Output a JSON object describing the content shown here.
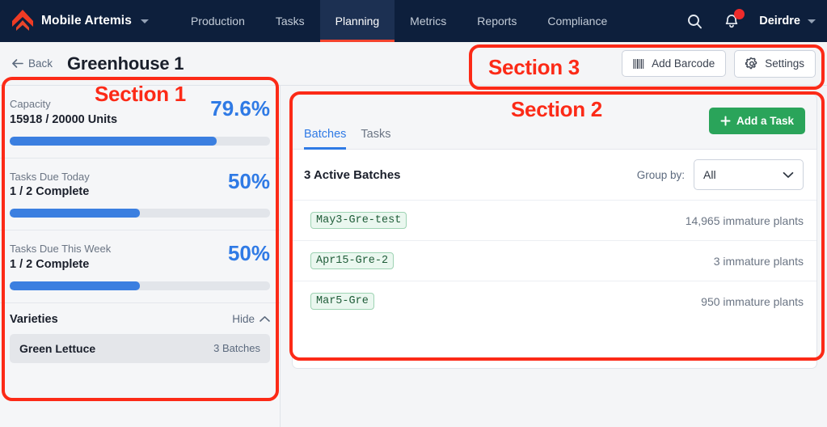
{
  "navbar": {
    "brand": "Mobile Artemis",
    "brand_caret_icon": "chevron-down-icon",
    "logo_icon": "flame-chevron-logo",
    "links": [
      {
        "label": "Production",
        "active": false
      },
      {
        "label": "Tasks",
        "active": false
      },
      {
        "label": "Planning",
        "active": true
      },
      {
        "label": "Metrics",
        "active": false
      },
      {
        "label": "Reports",
        "active": false
      },
      {
        "label": "Compliance",
        "active": false
      }
    ],
    "search_icon": "search-icon",
    "notifications_icon": "bell-icon",
    "notification_badge": true,
    "user": "Deirdre",
    "user_caret_icon": "chevron-down-icon",
    "background_color": "#0d1f3c",
    "active_underline_color": "#f4442e"
  },
  "page_header": {
    "back_label": "Back",
    "back_icon": "arrow-left-icon",
    "title": "Greenhouse 1",
    "actions": [
      {
        "label": "Add Barcode",
        "icon": "barcode-icon"
      },
      {
        "label": "Settings",
        "icon": "gear-icon"
      }
    ]
  },
  "sidebar": {
    "stats": [
      {
        "label": "Capacity",
        "sub": "15918 / 20000 Units",
        "percent_label": "79.6%",
        "percent_value": 79.6
      },
      {
        "label": "Tasks Due Today",
        "sub": "1 / 2 Complete",
        "percent_label": "50%",
        "percent_value": 50
      },
      {
        "label": "Tasks Due This Week",
        "sub": "1 / 2 Complete",
        "percent_label": "50%",
        "percent_value": 50
      }
    ],
    "varieties": {
      "title": "Varieties",
      "toggle_label": "Hide",
      "toggle_icon": "chevron-up-icon",
      "items": [
        {
          "name": "Green Lettuce",
          "count": "3 Batches"
        }
      ]
    },
    "accent_color": "#2f7ae5"
  },
  "main": {
    "tabs": [
      {
        "label": "Batches",
        "active": true
      },
      {
        "label": "Tasks",
        "active": false
      }
    ],
    "add_task_label": "Add a Task",
    "add_task_icon": "plus-icon",
    "add_task_color": "#2aa45a",
    "list_title": "3 Active Batches",
    "group_by_label": "Group by:",
    "group_by_value": "All",
    "group_by_caret_icon": "chevron-down-icon",
    "batches": [
      {
        "tag": "May3-Gre-test",
        "count": "14,965 immature plants"
      },
      {
        "tag": "Apr15-Gre-2",
        "count": "3 immature plants"
      },
      {
        "tag": "Mar5-Gre",
        "count": "950 immature plants"
      }
    ]
  },
  "annotations": {
    "color": "#fc2a17",
    "labels": [
      {
        "text": "Section 1"
      },
      {
        "text": "Section 2"
      },
      {
        "text": "Section 3"
      }
    ]
  }
}
